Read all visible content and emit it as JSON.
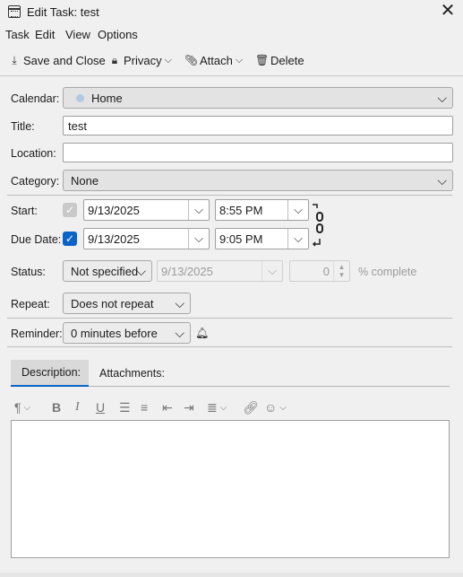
{
  "window": {
    "title": "Edit Task: test"
  },
  "menu": {
    "task": "Task",
    "edit": "Edit",
    "view": "View",
    "options": "Options"
  },
  "toolbar": {
    "save_close": "Save and Close",
    "privacy": "Privacy",
    "attach": "Attach",
    "delete": "Delete"
  },
  "form": {
    "calendar_label": "Calendar:",
    "calendar_value": "Home",
    "title_label": "Title:",
    "title_value": "test",
    "location_label": "Location:",
    "location_value": "",
    "category_label": "Category:",
    "category_value": "None",
    "start_label": "Start:",
    "start_date": "9/13/2025",
    "start_time": "8:55 PM",
    "due_label": "Due Date:",
    "due_date": "9/13/2025",
    "due_time": "9:05 PM",
    "status_label": "Status:",
    "status_value": "Not specified",
    "status_date": "9/13/2025",
    "percent_value": "0",
    "percent_label": "% complete",
    "repeat_label": "Repeat:",
    "repeat_value": "Does not repeat",
    "reminder_label": "Reminder:",
    "reminder_value": "0 minutes before"
  },
  "tabs": {
    "description": "Description:",
    "attachments": "Attachments:"
  },
  "icons": [
    "calendar-app-icon",
    "close-icon",
    "save-icon",
    "lock-icon",
    "paperclip-icon",
    "trash-icon",
    "chevron-down-icon",
    "bell-icon",
    "chain-link-icon",
    "paragraph-icon",
    "bold-icon",
    "italic-icon",
    "underline-icon",
    "bullet-list-icon",
    "numbered-list-icon",
    "outdent-icon",
    "indent-icon",
    "align-icon",
    "link-icon",
    "emoji-icon"
  ]
}
